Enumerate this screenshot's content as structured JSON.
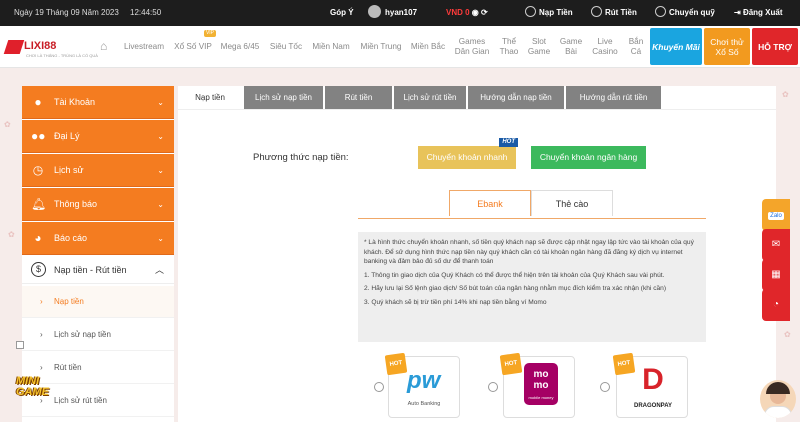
{
  "topbar": {
    "datetime": "Ngày 19 Tháng 09 Năm 2023",
    "time": "12:44:50",
    "feedback": "Góp Ý",
    "username": "hyan107",
    "balance": "VND 0",
    "deposit": "Nạp Tiền",
    "withdraw": "Rút Tiền",
    "transfer": "Chuyển quỹ",
    "logout": "Đăng Xuất"
  },
  "brand": {
    "logo": "LIXI88",
    "tagline": "CHƠI LÀ THẮNG - TRÚNG LÀ CÓ QUÀ"
  },
  "nav": {
    "items": [
      "Livestream",
      "Xổ Số VIP",
      "Mega 6/45",
      "Siêu Tốc",
      "Miền Nam",
      "Miền Trung",
      "Miền Bắc",
      "Games\nDân Gian",
      "Thể\nThao",
      "Slot\nGame",
      "Game\nBài",
      "Live\nCasino",
      "Bắn\nCá"
    ],
    "vip_badge": "VIP",
    "promo": "Khuyến Mãi",
    "free_play": "Chơi thử\nXổ Số",
    "support": "HỖ TRỢ"
  },
  "sidebar": {
    "items": [
      {
        "label": "Tài Khoản",
        "icon": "user-icon"
      },
      {
        "label": "Đại Lý",
        "icon": "group-icon"
      },
      {
        "label": "Lịch sử",
        "icon": "history-icon"
      },
      {
        "label": "Thông báo",
        "icon": "bell-icon"
      },
      {
        "label": "Báo cáo",
        "icon": "pie-chart-icon"
      }
    ],
    "open_section": {
      "label": "Nạp tiền - Rút tiền",
      "icon": "dollar-icon"
    },
    "sub_items": [
      "Nạp tiền",
      "Lịch sử nạp tiền",
      "Rút tiền",
      "Lịch sử rút tiền"
    ]
  },
  "tabs": [
    "Nạp tiền",
    "Lịch sử nạp tiền",
    "Rút tiền",
    "Lịch sử rút tiền",
    "Hướng dẫn nạp tiền",
    "Hướng dẫn rút tiền"
  ],
  "deposit": {
    "method_label": "Phương thức nạp tiền:",
    "methods": [
      "Chuyển khoản nhanh",
      "Chuyển khoản ngân hàng"
    ],
    "hot": "HOT",
    "subtabs": [
      "Ebank",
      "Thẻ cào"
    ],
    "notice": [
      "* Là hình thức chuyển khoản nhanh, số tiền quý khách nạp sẽ được cập nhật ngay lập tức vào tài khoản của quý khách. Để sử dụng hình thức nạp tiền này quý khách cần có tài khoản ngân hàng đã đăng ký dịch vụ internet banking và đảm bảo đủ số dư để thanh toán",
      "1. Thông tin giao dịch của Quý Khách có thể được thể hiện trên tài khoản của Quý Khách sau vài phút.",
      "2. Hãy lưu lại Số lệnh giao dịch/ Số bút toán của ngân hàng nhằm mục đích kiểm tra xác nhận (khi cần)",
      "3. Quý khách sẽ bị trừ tiền phí 14% khi nạp tiền bằng ví Momo"
    ],
    "providers": [
      {
        "name": "Auto Banking",
        "logo": "pw"
      },
      {
        "name": "mobile money",
        "logo": "mo mo"
      },
      {
        "name": "DRAGONPAY",
        "logo": "D"
      }
    ],
    "hot_badge": "HOT"
  },
  "right_rail": [
    "Zalo",
    "mail-icon",
    "qr-icon",
    "speed-icon"
  ],
  "minigame": "MINI GAME",
  "colors": {
    "orange": "#f47c20",
    "tab_gray": "#828282",
    "yellow_btn": "#e8c35a",
    "green_btn": "#3cb95d",
    "red": "#e0262a",
    "blue_promo": "#1aa5e0",
    "orange_promo": "#f29a1f"
  }
}
